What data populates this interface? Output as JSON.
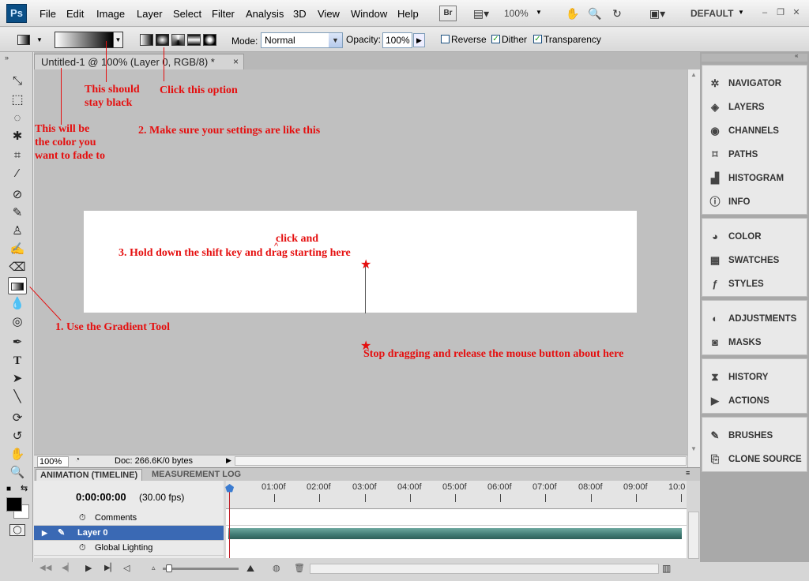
{
  "app": {
    "logo": "Ps",
    "zoom": "100%",
    "workspace": "DEFAULT"
  },
  "menu": [
    "File",
    "Edit",
    "Image",
    "Layer",
    "Select",
    "Filter",
    "Analysis",
    "3D",
    "View",
    "Window",
    "Help"
  ],
  "toolbar_icons": [
    "bridge-icon",
    "screen-mode-icon",
    "hand-icon",
    "zoom-icon",
    "rotate-view-icon",
    "arrange-documents-icon"
  ],
  "options": {
    "mode_label": "Mode:",
    "mode_value": "Normal",
    "opacity_label": "Opacity:",
    "opacity_value": "100%",
    "reverse_label": "Reverse",
    "dither_label": "Dither",
    "transparency_label": "Transparency",
    "reverse_checked": false,
    "dither_checked": true,
    "transparency_checked": true
  },
  "document": {
    "tab_title": "Untitled-1 @ 100% (Layer 0, RGB/8) *",
    "close": "×"
  },
  "status": {
    "zoom": "100%",
    "doc_info": "Doc: 266.6K/0 bytes"
  },
  "annotations": {
    "stay_black": "This should\nstay black",
    "click_option": "Click this option",
    "fade_color": "This will be\nthe color you\nwant to fade to",
    "settings": "2. Make sure your settings are like this",
    "click_and": "click and",
    "hold_shift": "3. Hold down the shift key and drag starting here",
    "stop_dragging": "Stop dragging and release the mouse button about here",
    "gradient_tool": "1.  Use the Gradient Tool"
  },
  "panels": [
    {
      "group": 1,
      "items": [
        {
          "label": "NAVIGATOR",
          "icon": "✲"
        },
        {
          "label": "LAYERS",
          "icon": "◈"
        },
        {
          "label": "CHANNELS",
          "icon": "◉"
        },
        {
          "label": "PATHS",
          "icon": "⌑"
        },
        {
          "label": "HISTOGRAM",
          "icon": "▟"
        },
        {
          "label": "INFO",
          "icon": "ⓘ"
        }
      ]
    },
    {
      "group": 2,
      "items": [
        {
          "label": "COLOR",
          "icon": "◕"
        },
        {
          "label": "SWATCHES",
          "icon": "▦"
        },
        {
          "label": "STYLES",
          "icon": "ƒ"
        }
      ]
    },
    {
      "group": 3,
      "items": [
        {
          "label": "ADJUSTMENTS",
          "icon": "◐"
        },
        {
          "label": "MASKS",
          "icon": "◙"
        }
      ]
    },
    {
      "group": 4,
      "items": [
        {
          "label": "HISTORY",
          "icon": "⧗"
        },
        {
          "label": "ACTIONS",
          "icon": "▶"
        }
      ]
    },
    {
      "group": 5,
      "items": [
        {
          "label": "BRUSHES",
          "icon": "✎"
        },
        {
          "label": "CLONE SOURCE",
          "icon": "⎘"
        }
      ]
    }
  ],
  "timeline": {
    "tabs": [
      "ANIMATION (TIMELINE)",
      "MEASUREMENT LOG"
    ],
    "timecode": "0:00:00:00",
    "fps": "(30.00 fps)",
    "ruler": [
      "01:00f",
      "02:00f",
      "03:00f",
      "04:00f",
      "05:00f",
      "06:00f",
      "07:00f",
      "08:00f",
      "09:00f",
      "10:0"
    ],
    "rows": [
      "Comments",
      "Layer 0",
      "Global Lighting"
    ]
  },
  "colors": {
    "accent_red": "#e50f0f",
    "layer_highlight": "#3a69b4",
    "foreground": "#000000",
    "background": "#ffffff"
  }
}
